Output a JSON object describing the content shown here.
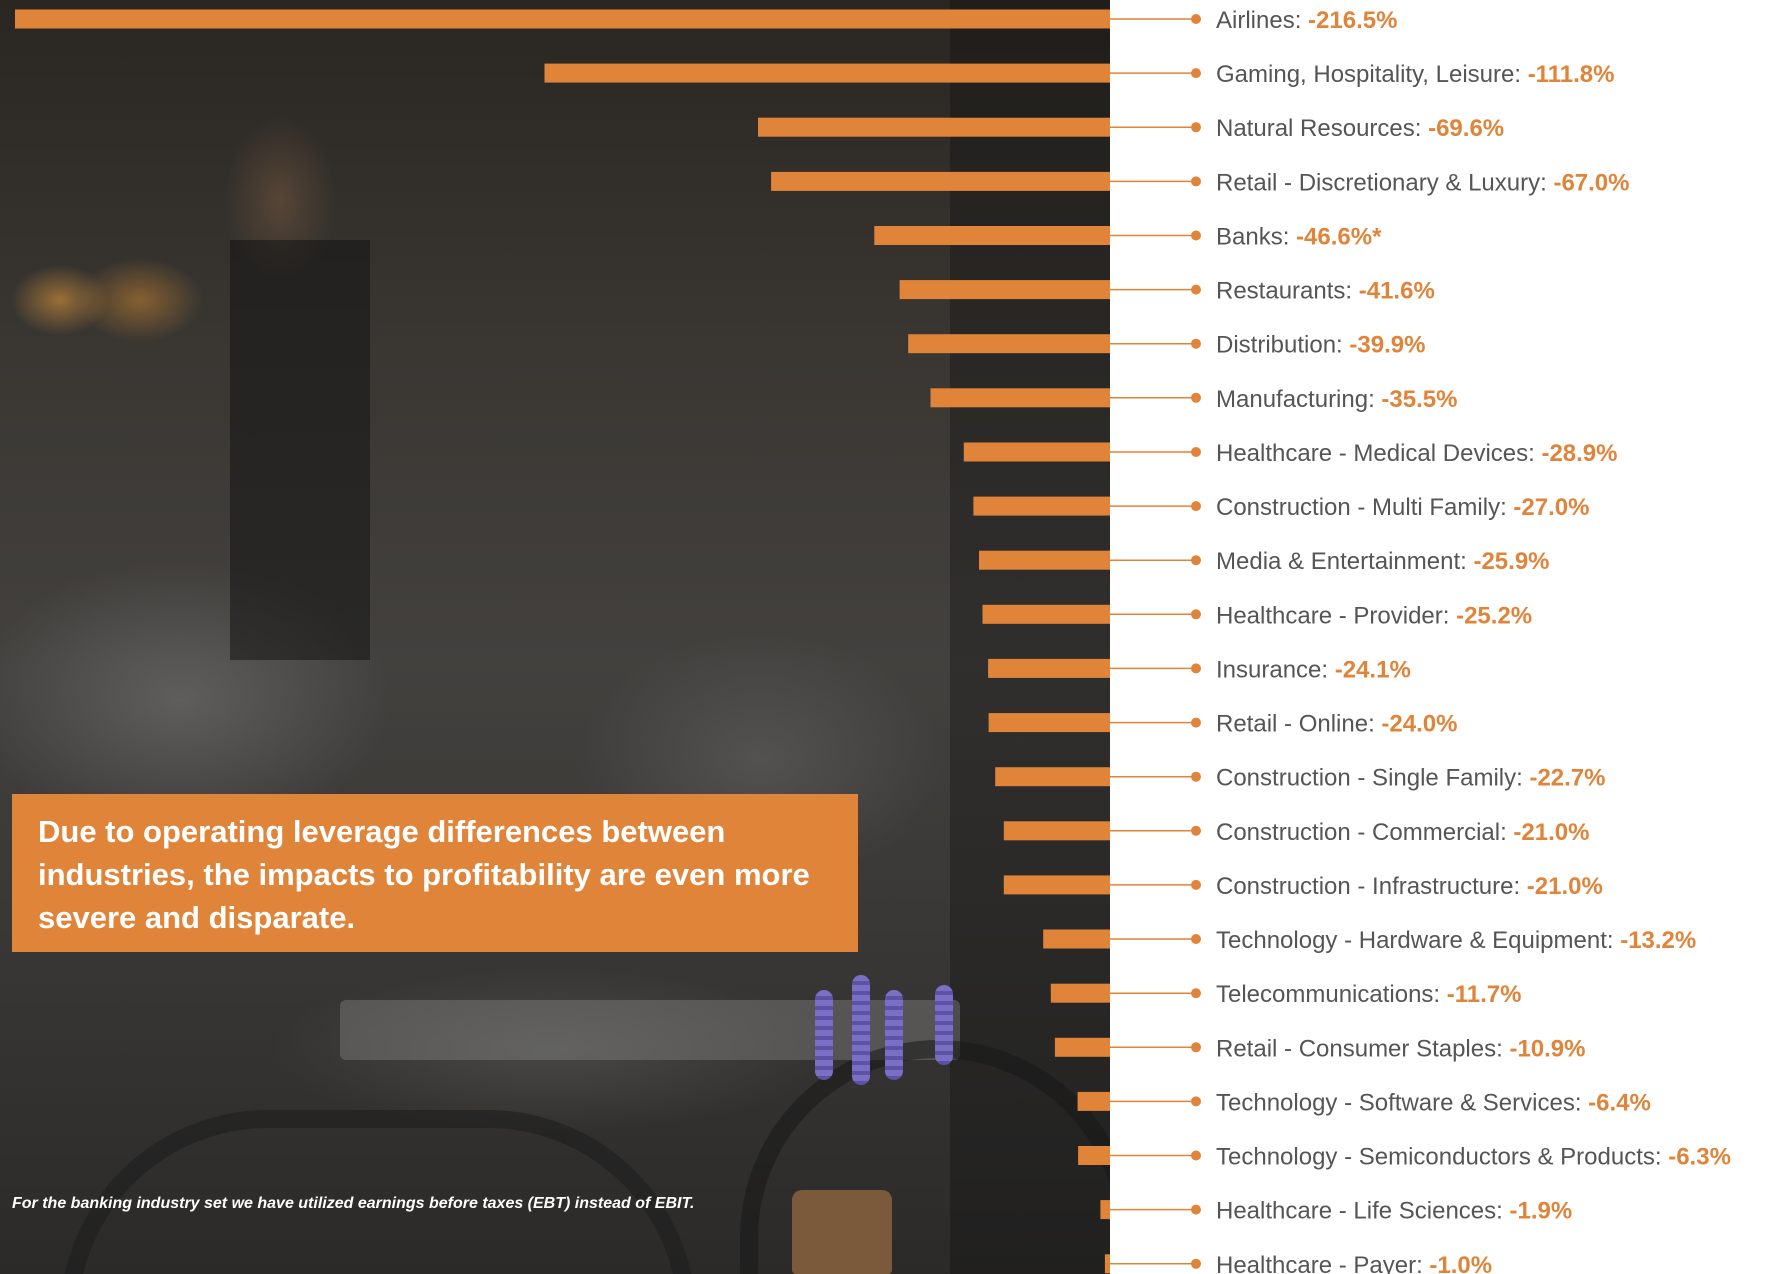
{
  "chart_data": {
    "type": "bar",
    "orientation": "horizontal",
    "title": "Due to operating leverage differences between industries, the impacts to profitability are even more severe and disparate.",
    "footnote": "For the banking industry set we have utilized earnings before taxes (EBT) instead of EBIT.",
    "value_suffix": "%",
    "bar_color": "#e0843a",
    "label_color": "#555555",
    "value_color": "#e0843a",
    "categories": [
      "Airlines",
      "Gaming, Hospitality, Leisure",
      "Natural Resources",
      "Retail - Discretionary & Luxury",
      "Banks",
      "Restaurants",
      "Distribution",
      "Manufacturing",
      "Healthcare - Medical Devices",
      "Construction - Multi Family",
      "Media & Entertainment",
      "Healthcare - Provider",
      "Insurance",
      "Retail - Online",
      "Construction - Single Family",
      "Construction - Commercial",
      "Construction - Infrastructure",
      "Technology - Hardware & Equipment",
      "Telecommunications",
      "Retail - Consumer Staples",
      "Technology - Software & Services",
      "Technology - Semiconductors & Products",
      "Healthcare - Life Sciences",
      "Healthcare - Payer"
    ],
    "values": [
      -216.5,
      -111.8,
      -69.6,
      -67.0,
      -46.6,
      -41.6,
      -39.9,
      -35.5,
      -28.9,
      -27.0,
      -25.9,
      -25.2,
      -24.1,
      -24.0,
      -22.7,
      -21.0,
      -21.0,
      -13.2,
      -11.7,
      -10.9,
      -6.4,
      -6.3,
      -1.9,
      -1.0
    ],
    "value_labels": [
      "-216.5%",
      "-111.8%",
      "-69.6%",
      "-67.0%",
      "-46.6%*",
      "-41.6%",
      "-39.9%",
      "-35.5%",
      "-28.9%",
      "-27.0%",
      "-25.9%",
      "-25.2%",
      "-24.1%",
      "-24.0%",
      "-22.7%",
      "-21.0%",
      "-21.0%",
      "-13.2%",
      "-11.7%",
      "-10.9%",
      "-6.4%",
      "-6.3%",
      "-1.9%",
      "-1.0%"
    ],
    "xlim": [
      -216.5,
      0
    ],
    "grid": false,
    "legend": "none"
  }
}
